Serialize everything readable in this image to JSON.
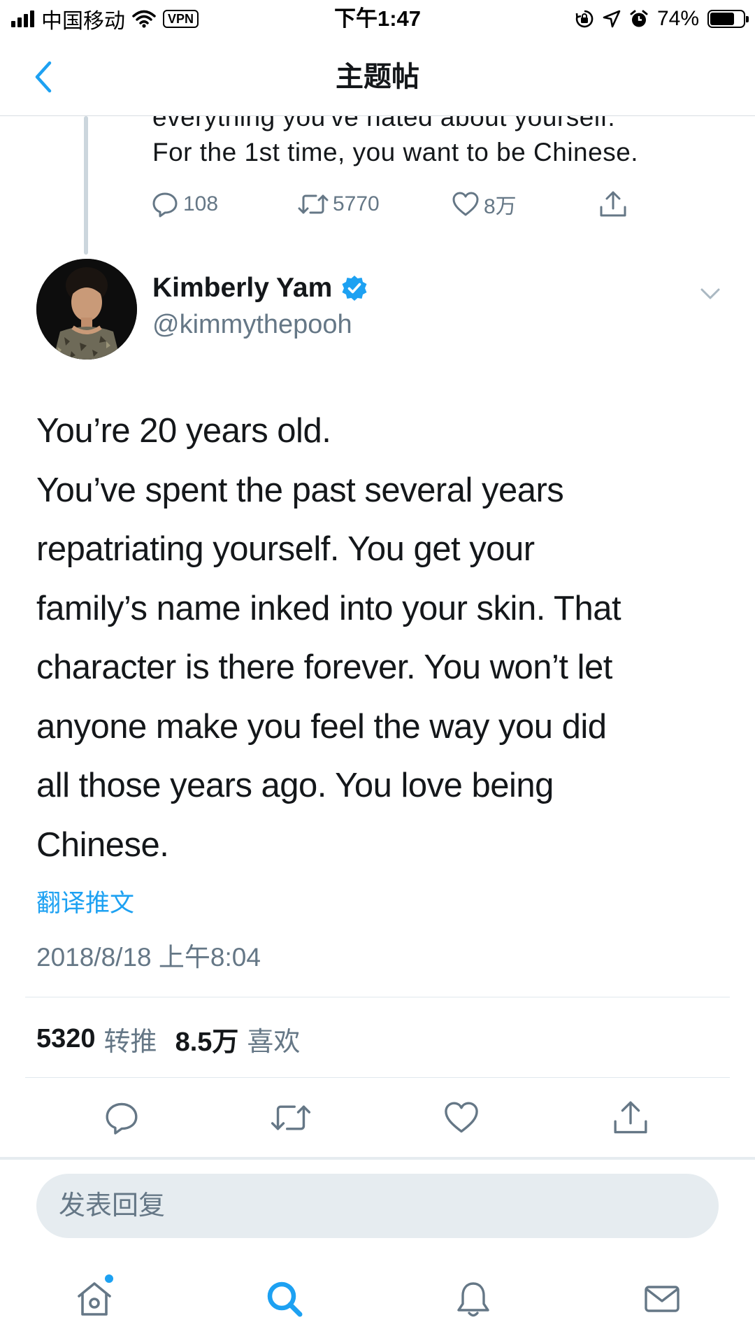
{
  "status_bar": {
    "carrier": "中国移动",
    "vpn_label": "VPN",
    "time": "下午1:47",
    "battery_percent": "74%",
    "battery_level": 0.74,
    "signal_bars": 4
  },
  "nav": {
    "title": "主题帖",
    "back_icon": "chevron-left-icon"
  },
  "previous_tweet": {
    "text_clipped": "everything you've hated about yourself.",
    "text_last_line": "For the 1st time, you want to be Chinese.",
    "reply_count": "108",
    "retweet_count": "5770",
    "like_count": "8万"
  },
  "tweet": {
    "author_name": "Kimberly Yam",
    "verified": true,
    "handle": "@kimmythepooh",
    "body_lines": [
      "You’re 20 years old.",
      "You’ve spent the past several years",
      "repatriating yourself. You get your",
      "family’s name inked into your skin. That",
      "character is there forever. You won’t let",
      "anyone make you feel the way you did",
      "all those years ago. You love being",
      "Chinese."
    ],
    "translate_label": "翻译推文",
    "timestamp": "2018/8/18 上午8:04",
    "retweets_num": "5320",
    "retweets_label": "转推",
    "likes_num": "8.5万",
    "likes_label": "喜欢"
  },
  "reply": {
    "placeholder": "发表回复"
  },
  "tab_bar": {
    "items": [
      "home-icon",
      "search-icon",
      "notifications-icon",
      "messages-icon"
    ],
    "active": "search-icon"
  },
  "colors": {
    "accent": "#1da1f2",
    "text_primary": "#14171a",
    "text_secondary": "#657786",
    "divider": "#e1e8ed"
  }
}
